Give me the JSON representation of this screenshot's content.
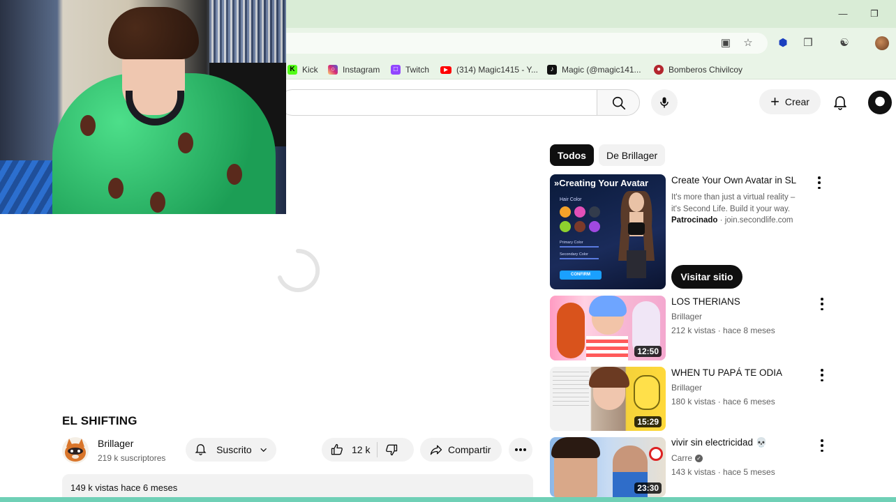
{
  "bookmarks": [
    {
      "label": "Kick",
      "icon": "kick-icon",
      "color": "#53fc18"
    },
    {
      "label": "Instagram",
      "icon": "instagram-icon",
      "color": "#d62976"
    },
    {
      "label": "Twitch",
      "icon": "twitch-icon",
      "color": "#9146ff"
    },
    {
      "label": "(314) Magic1415 - Y...",
      "icon": "youtube-icon",
      "color": "#ff0000"
    },
    {
      "label": "Magic (@magic141...",
      "icon": "tiktok-icon",
      "color": "#111111"
    },
    {
      "label": "Bomberos Chivilcoy",
      "icon": "bomberos-icon",
      "color": "#b3262e"
    }
  ],
  "header": {
    "create_label": "Crear"
  },
  "video": {
    "title": "EL SHIFTING",
    "channel": "Brillager",
    "subscribers": "219 k suscriptores",
    "subscribe_label": "Suscrito",
    "likes": "12 k",
    "share_label": "Compartir",
    "views_date": "149 k vistas  hace 6 meses"
  },
  "chips": {
    "all": "Todos",
    "from_channel": "De Brillager"
  },
  "ad": {
    "thumb_text": "»Creating Your Avatar",
    "thumb_hair": "Hair Color",
    "thumb_primary": "Primary Color",
    "thumb_secondary": "Secondary Color",
    "thumb_confirm": "CONFIRM",
    "title": "Create Your Own Avatar in SL",
    "description": "It's more than just a virtual reality – it's Second Life. Build it your way.",
    "sponsored": "Patrocinado",
    "domain": "· join.secondlife.com",
    "visit_label": "Visitar sitio"
  },
  "recommendations": [
    {
      "title": "LOS THERIANS",
      "channel": "Brillager",
      "meta": "212 k vistas · hace 8 meses",
      "duration": "12:50"
    },
    {
      "title": "WHEN TU PAPÁ TE ODIA",
      "channel": "Brillager",
      "meta": "180 k vistas · hace 6 meses",
      "duration": "15:29"
    },
    {
      "title": "vivir sin electricidad 💀",
      "channel": "Carre",
      "meta": "143 k vistas · hace 5 meses",
      "duration": "23:30"
    }
  ]
}
